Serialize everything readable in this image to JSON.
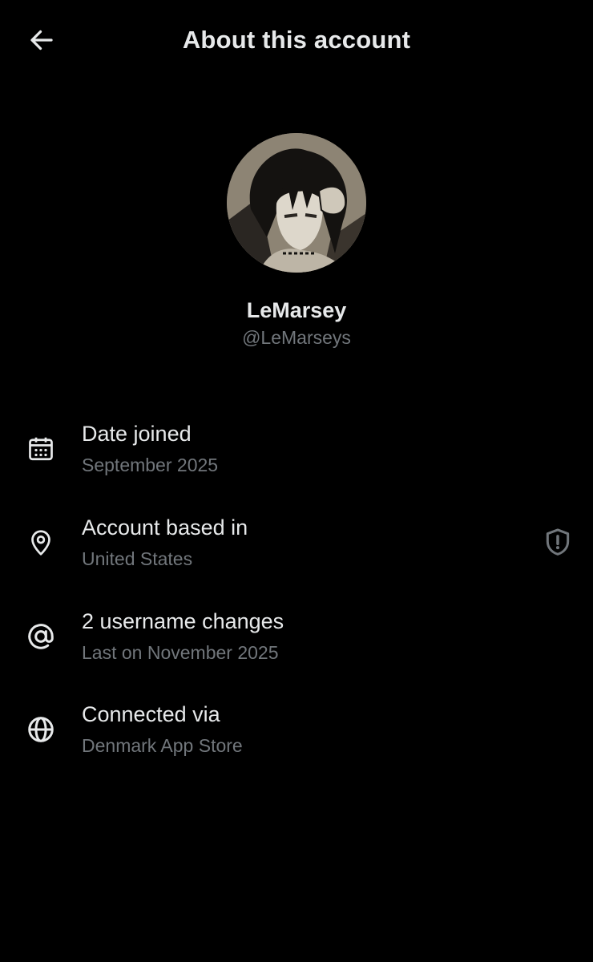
{
  "header": {
    "title": "About this account",
    "back_icon": "arrow-left-icon"
  },
  "profile": {
    "display_name": "LeMarsey",
    "handle": "@LeMarseys",
    "avatar": "anime-avatar-image"
  },
  "details": [
    {
      "icon": "calendar-icon",
      "title": "Date joined",
      "subtitle": "September 2025"
    },
    {
      "icon": "location-pin-icon",
      "title": "Account based in",
      "subtitle": "United States",
      "trailing_icon": "shield-alert-icon"
    },
    {
      "icon": "at-sign-icon",
      "title": "2 username changes",
      "subtitle": "Last on November 2025"
    },
    {
      "icon": "globe-icon",
      "title": "Connected via",
      "subtitle": "Denmark App Store"
    }
  ],
  "colors": {
    "background": "#000000",
    "primary_text": "#e7e9ea",
    "secondary_text": "#71767b"
  }
}
